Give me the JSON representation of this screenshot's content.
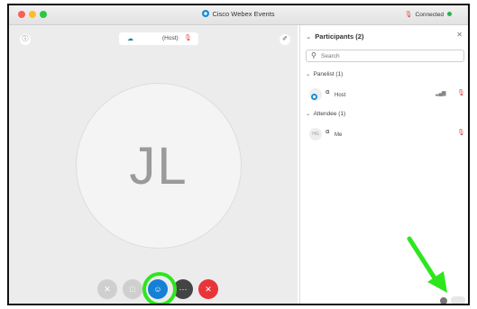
{
  "window": {
    "title": "Cisco Webex Events",
    "connection_status": "Connected"
  },
  "stage": {
    "host_label": "(Host)",
    "avatar_initials": "JL",
    "icons": {
      "info": "info-icon",
      "pin": "pin-icon",
      "cloud": "cloud-icon",
      "mic": "mic-muted-icon"
    },
    "controls": [
      {
        "name": "mute-button",
        "icon": "mic-off-icon",
        "color": "#cfcfcf"
      },
      {
        "name": "video-button",
        "icon": "video-off-icon",
        "color": "#cfcfcf"
      },
      {
        "name": "participants-button",
        "icon": "participants-icon",
        "color": "#1580d6"
      },
      {
        "name": "more-button",
        "icon": "more-icon",
        "color": "#444444"
      },
      {
        "name": "leave-button",
        "icon": "close-icon",
        "color": "#e8353a"
      }
    ]
  },
  "panel": {
    "title": "Participants (2)",
    "search_placeholder": "Search",
    "sections": {
      "panelist": "Panelist (1)",
      "attendee": "Attendee (1)"
    },
    "participants": [
      {
        "name": "Host",
        "initials": "",
        "role": "panelist",
        "muted": true
      },
      {
        "name": "Me",
        "initials": "HG",
        "role": "attendee",
        "muted": true
      }
    ]
  },
  "colors": {
    "accent": "#1580d6",
    "leave": "#e8353a",
    "highlight": "#2ee61d",
    "connected": "#27b34a"
  }
}
